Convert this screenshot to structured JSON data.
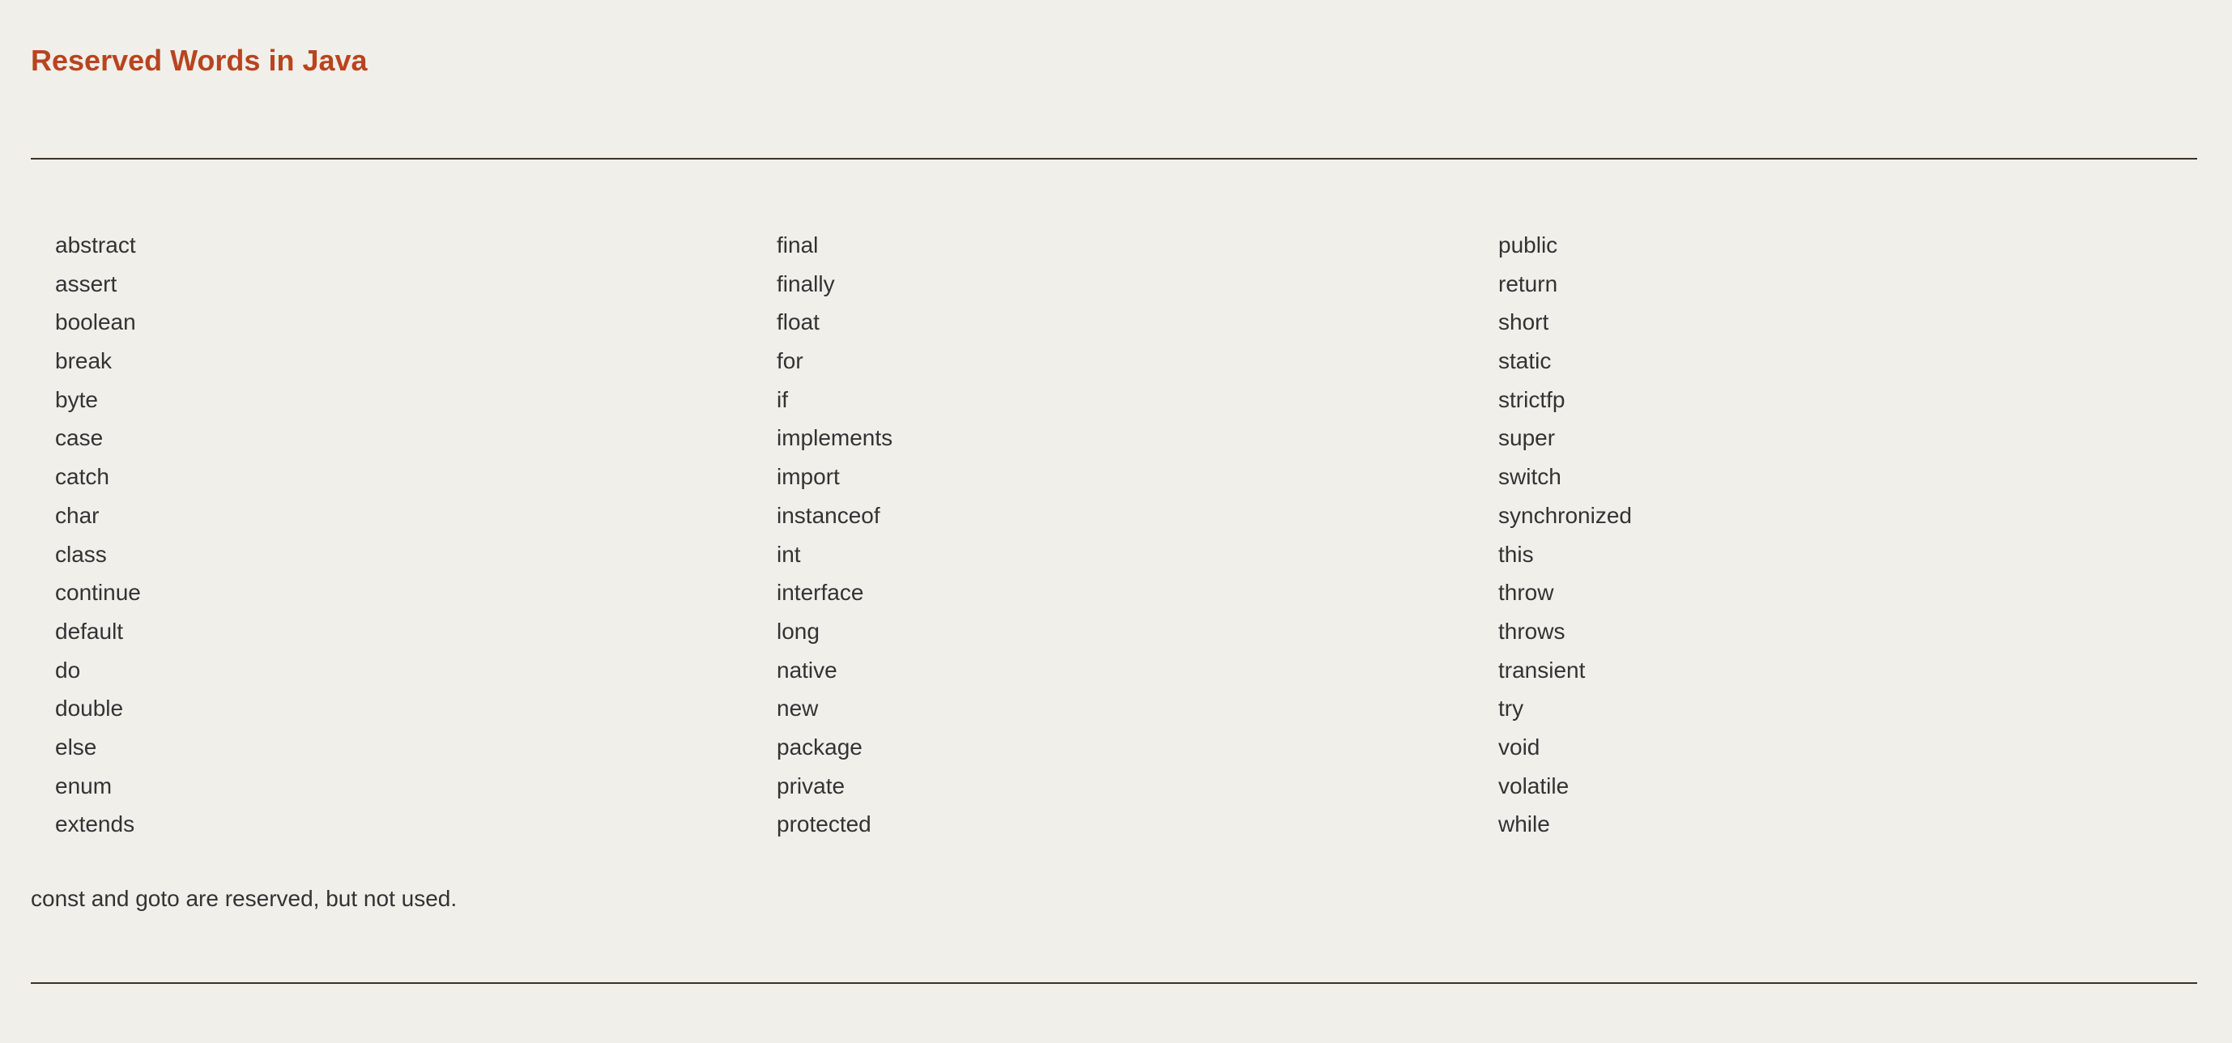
{
  "page": {
    "title": "Reserved Words in Java",
    "footnote": "const and goto are reserved, but not used."
  },
  "colors": {
    "background": "#f1efea",
    "title": "#b8441f",
    "text": "#333333",
    "rule": "#3a3424"
  },
  "keywords": {
    "column_1": [
      "abstract",
      "assert",
      "boolean",
      "break",
      "byte",
      "case",
      "catch",
      "char",
      "class",
      "continue",
      "default",
      "do",
      "double",
      "else",
      "enum",
      "extends"
    ],
    "column_2": [
      "final",
      "finally",
      "float",
      "for",
      "if",
      "implements",
      "import",
      "instanceof",
      "int",
      "interface",
      "long",
      "native",
      "new",
      "package",
      "private",
      "protected"
    ],
    "column_3": [
      "public",
      "return",
      "short",
      "static",
      "strictfp",
      "super",
      "switch",
      "synchronized",
      "this",
      "throw",
      "throws",
      "transient",
      "try",
      "void",
      "volatile",
      "while"
    ]
  }
}
